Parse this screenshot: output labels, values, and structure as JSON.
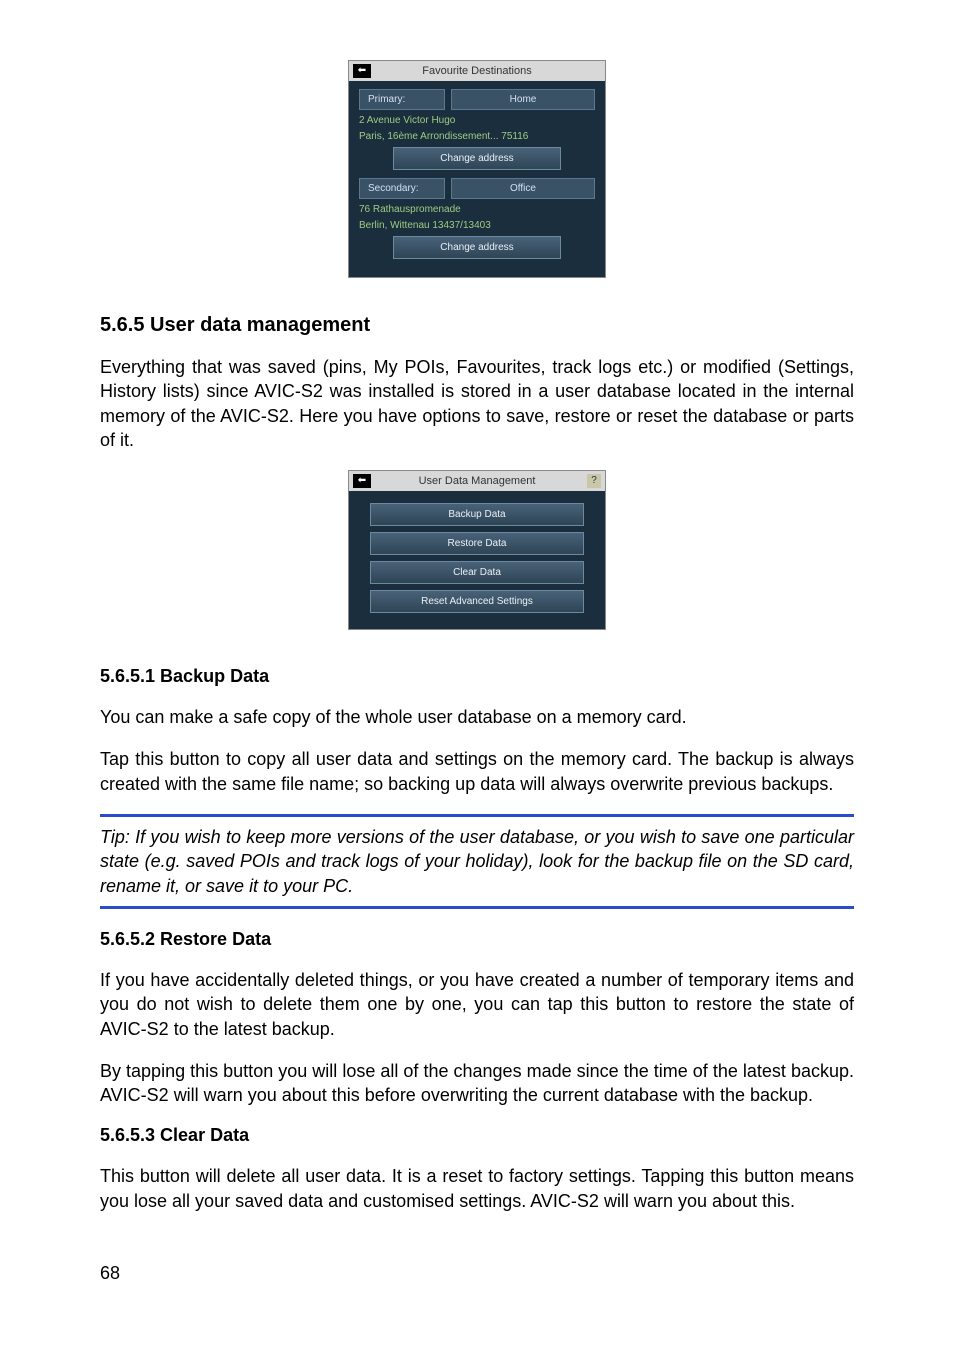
{
  "screenshot1": {
    "title": "Favourite Destinations",
    "back": "⬅",
    "primary_label": "Primary:",
    "primary_value": "Home",
    "addr1_line1": "2 Avenue Victor Hugo",
    "addr1_line2": "Paris, 16ème Arrondissement... 75116",
    "change1": "Change address",
    "secondary_label": "Secondary:",
    "secondary_value": "Office",
    "addr2_line1": "76 Rathauspromenade",
    "addr2_line2": "Berlin, Wittenau 13437/13403",
    "change2": "Change address"
  },
  "sec_565": {
    "heading": "5.6.5  User data management",
    "para": "Everything that was saved (pins, My POIs, Favourites, track logs etc.) or modified (Settings, History lists) since AVIC-S2 was installed is stored in a user database located in the internal memory of the AVIC-S2. Here you have options to save, restore or reset the database or parts of it."
  },
  "screenshot2": {
    "title": "User Data Management",
    "back": "⬅",
    "help": "?",
    "b1": "Backup Data",
    "b2": "Restore Data",
    "b3": "Clear Data",
    "b4": "Reset Advanced Settings"
  },
  "sec_5651": {
    "heading": "5.6.5.1  Backup Data",
    "p1": "You can make a safe copy of the whole user database on a memory card.",
    "p2": "Tap this button to copy all user data and settings on the memory card. The backup is always created with the same file name; so backing up data will always overwrite previous backups.",
    "tip": "Tip: If you wish to keep more versions of the user database, or you wish to save one particular state (e.g. saved POIs and track logs of your holiday), look for the backup file on the SD card, rename it, or save it to your PC."
  },
  "sec_5652": {
    "heading": "5.6.5.2  Restore Data",
    "p1": "If you have accidentally deleted things, or you have created a number of temporary items and you do not wish to delete them one by one, you can tap this button to restore the state of AVIC-S2 to the latest backup.",
    "p2": "By tapping this button you will lose all of the changes made since the time of the latest backup. AVIC-S2 will warn you about this before overwriting the current database with the backup."
  },
  "sec_5653": {
    "heading": "5.6.5.3  Clear Data",
    "p1": "This button will delete all user data. It is a reset to factory settings. Tapping this button means you lose all your saved data and customised settings. AVIC-S2 will warn you about this."
  },
  "page_number": "68"
}
